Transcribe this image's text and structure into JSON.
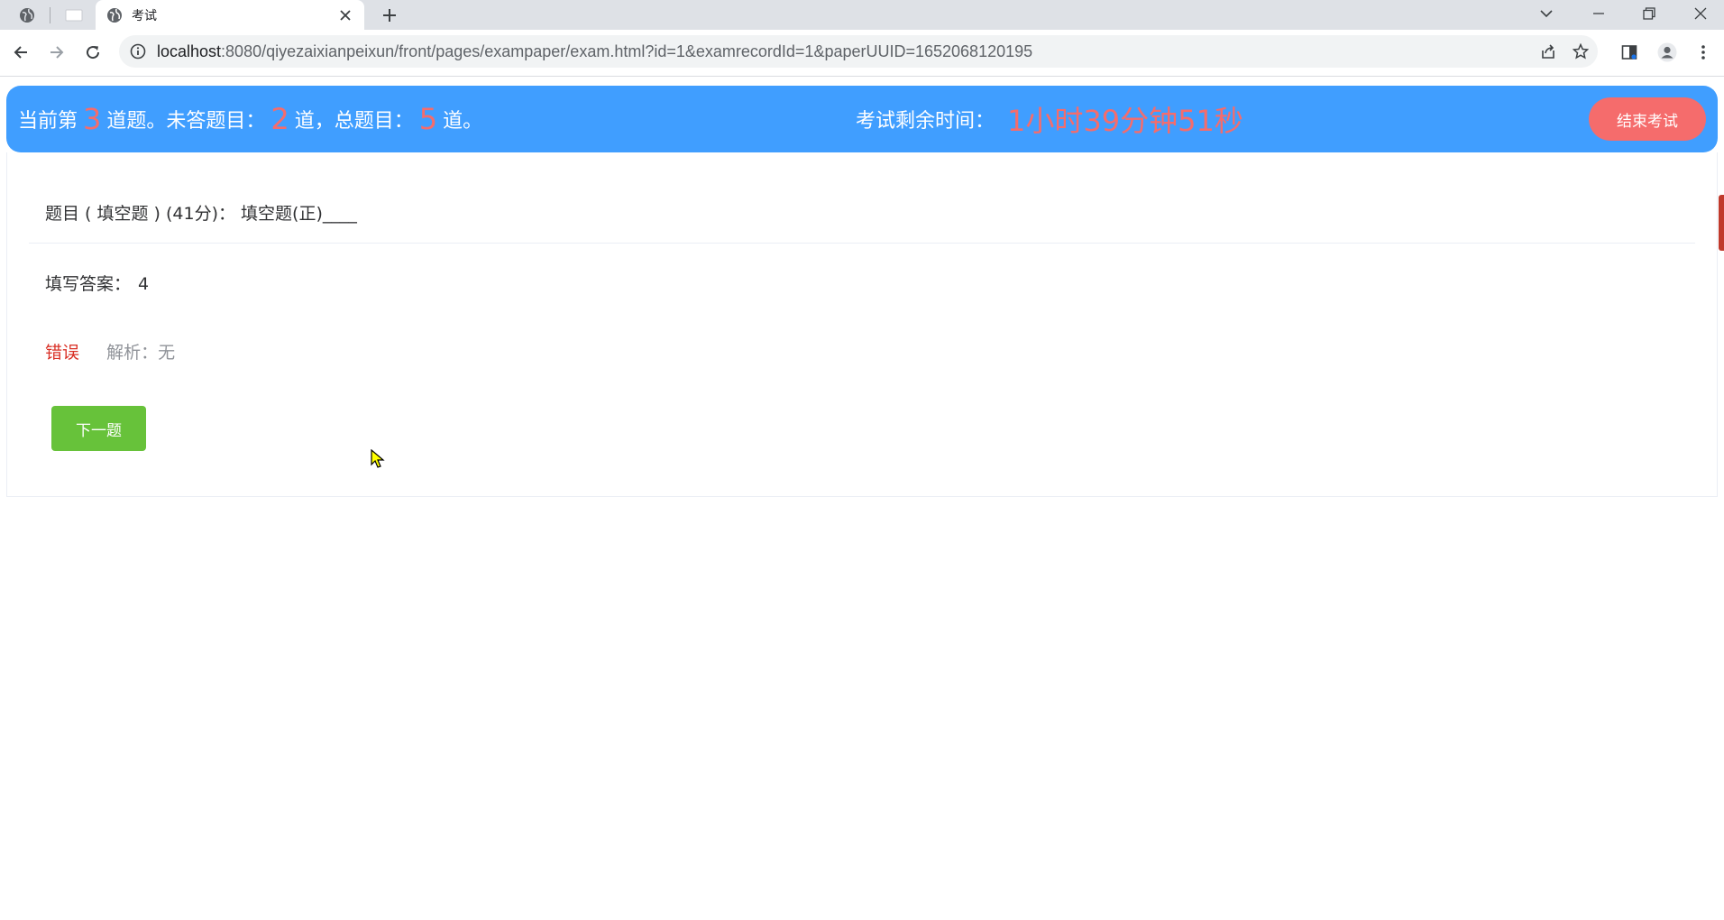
{
  "browser": {
    "tab_title": "考试",
    "url_host": "localhost",
    "url_path": ":8080/qiyezaixianpeixun/front/pages/exampaper/exam.html?id=1&examrecordId=1&paperUUID=1652068120195"
  },
  "banner": {
    "current_prefix": "当前第",
    "current_num": "3",
    "unanswered_prefix": "道题。未答题目：",
    "unanswered_num": "2",
    "total_prefix": "道，总题目：",
    "total_num": "5",
    "total_suffix": "道。",
    "timer_label": "考试剩余时间：",
    "timer_value": "1小时39分钟51秒",
    "end_button": "结束考试"
  },
  "question": {
    "text": "题目 ( 填空题 ) (41分)：  填空题(正)____",
    "answer_label": "填写答案：",
    "answer_value": "4",
    "result": "错误",
    "analysis_label": "解析：",
    "analysis_value": "无",
    "next_button": "下一题"
  },
  "colors": {
    "banner_bg": "#409eff",
    "highlight_num": "#f56c6c",
    "end_button_bg": "#f56c6c",
    "next_button_bg": "#67c23a",
    "wrong_text": "#d93026"
  }
}
